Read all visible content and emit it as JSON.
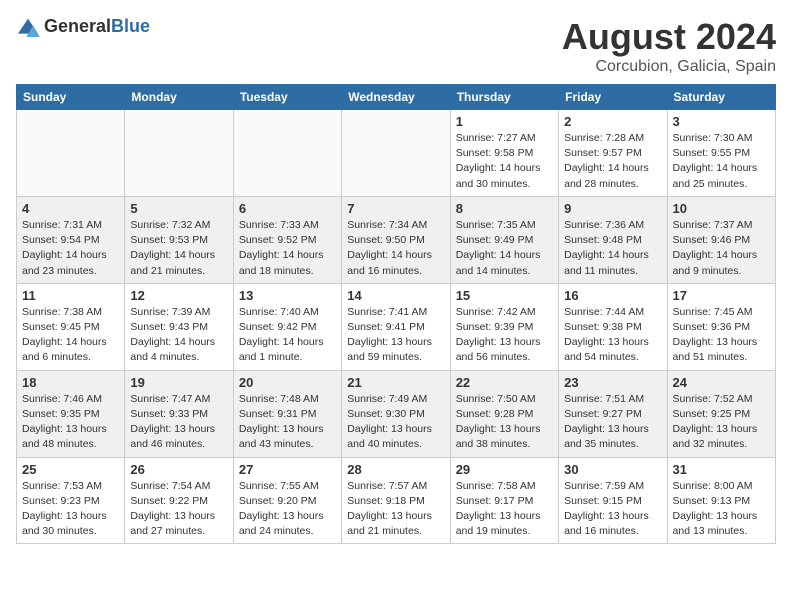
{
  "logo": {
    "general": "General",
    "blue": "Blue"
  },
  "title": "August 2024",
  "subtitle": "Corcubion, Galicia, Spain",
  "days_of_week": [
    "Sunday",
    "Monday",
    "Tuesday",
    "Wednesday",
    "Thursday",
    "Friday",
    "Saturday"
  ],
  "weeks": [
    [
      {
        "day": "",
        "info": ""
      },
      {
        "day": "",
        "info": ""
      },
      {
        "day": "",
        "info": ""
      },
      {
        "day": "",
        "info": ""
      },
      {
        "day": "1",
        "info": "Sunrise: 7:27 AM\nSunset: 9:58 PM\nDaylight: 14 hours and 30 minutes."
      },
      {
        "day": "2",
        "info": "Sunrise: 7:28 AM\nSunset: 9:57 PM\nDaylight: 14 hours and 28 minutes."
      },
      {
        "day": "3",
        "info": "Sunrise: 7:30 AM\nSunset: 9:55 PM\nDaylight: 14 hours and 25 minutes."
      }
    ],
    [
      {
        "day": "4",
        "info": "Sunrise: 7:31 AM\nSunset: 9:54 PM\nDaylight: 14 hours and 23 minutes."
      },
      {
        "day": "5",
        "info": "Sunrise: 7:32 AM\nSunset: 9:53 PM\nDaylight: 14 hours and 21 minutes."
      },
      {
        "day": "6",
        "info": "Sunrise: 7:33 AM\nSunset: 9:52 PM\nDaylight: 14 hours and 18 minutes."
      },
      {
        "day": "7",
        "info": "Sunrise: 7:34 AM\nSunset: 9:50 PM\nDaylight: 14 hours and 16 minutes."
      },
      {
        "day": "8",
        "info": "Sunrise: 7:35 AM\nSunset: 9:49 PM\nDaylight: 14 hours and 14 minutes."
      },
      {
        "day": "9",
        "info": "Sunrise: 7:36 AM\nSunset: 9:48 PM\nDaylight: 14 hours and 11 minutes."
      },
      {
        "day": "10",
        "info": "Sunrise: 7:37 AM\nSunset: 9:46 PM\nDaylight: 14 hours and 9 minutes."
      }
    ],
    [
      {
        "day": "11",
        "info": "Sunrise: 7:38 AM\nSunset: 9:45 PM\nDaylight: 14 hours and 6 minutes."
      },
      {
        "day": "12",
        "info": "Sunrise: 7:39 AM\nSunset: 9:43 PM\nDaylight: 14 hours and 4 minutes."
      },
      {
        "day": "13",
        "info": "Sunrise: 7:40 AM\nSunset: 9:42 PM\nDaylight: 14 hours and 1 minute."
      },
      {
        "day": "14",
        "info": "Sunrise: 7:41 AM\nSunset: 9:41 PM\nDaylight: 13 hours and 59 minutes."
      },
      {
        "day": "15",
        "info": "Sunrise: 7:42 AM\nSunset: 9:39 PM\nDaylight: 13 hours and 56 minutes."
      },
      {
        "day": "16",
        "info": "Sunrise: 7:44 AM\nSunset: 9:38 PM\nDaylight: 13 hours and 54 minutes."
      },
      {
        "day": "17",
        "info": "Sunrise: 7:45 AM\nSunset: 9:36 PM\nDaylight: 13 hours and 51 minutes."
      }
    ],
    [
      {
        "day": "18",
        "info": "Sunrise: 7:46 AM\nSunset: 9:35 PM\nDaylight: 13 hours and 48 minutes."
      },
      {
        "day": "19",
        "info": "Sunrise: 7:47 AM\nSunset: 9:33 PM\nDaylight: 13 hours and 46 minutes."
      },
      {
        "day": "20",
        "info": "Sunrise: 7:48 AM\nSunset: 9:31 PM\nDaylight: 13 hours and 43 minutes."
      },
      {
        "day": "21",
        "info": "Sunrise: 7:49 AM\nSunset: 9:30 PM\nDaylight: 13 hours and 40 minutes."
      },
      {
        "day": "22",
        "info": "Sunrise: 7:50 AM\nSunset: 9:28 PM\nDaylight: 13 hours and 38 minutes."
      },
      {
        "day": "23",
        "info": "Sunrise: 7:51 AM\nSunset: 9:27 PM\nDaylight: 13 hours and 35 minutes."
      },
      {
        "day": "24",
        "info": "Sunrise: 7:52 AM\nSunset: 9:25 PM\nDaylight: 13 hours and 32 minutes."
      }
    ],
    [
      {
        "day": "25",
        "info": "Sunrise: 7:53 AM\nSunset: 9:23 PM\nDaylight: 13 hours and 30 minutes."
      },
      {
        "day": "26",
        "info": "Sunrise: 7:54 AM\nSunset: 9:22 PM\nDaylight: 13 hours and 27 minutes."
      },
      {
        "day": "27",
        "info": "Sunrise: 7:55 AM\nSunset: 9:20 PM\nDaylight: 13 hours and 24 minutes."
      },
      {
        "day": "28",
        "info": "Sunrise: 7:57 AM\nSunset: 9:18 PM\nDaylight: 13 hours and 21 minutes."
      },
      {
        "day": "29",
        "info": "Sunrise: 7:58 AM\nSunset: 9:17 PM\nDaylight: 13 hours and 19 minutes."
      },
      {
        "day": "30",
        "info": "Sunrise: 7:59 AM\nSunset: 9:15 PM\nDaylight: 13 hours and 16 minutes."
      },
      {
        "day": "31",
        "info": "Sunrise: 8:00 AM\nSunset: 9:13 PM\nDaylight: 13 hours and 13 minutes."
      }
    ]
  ]
}
